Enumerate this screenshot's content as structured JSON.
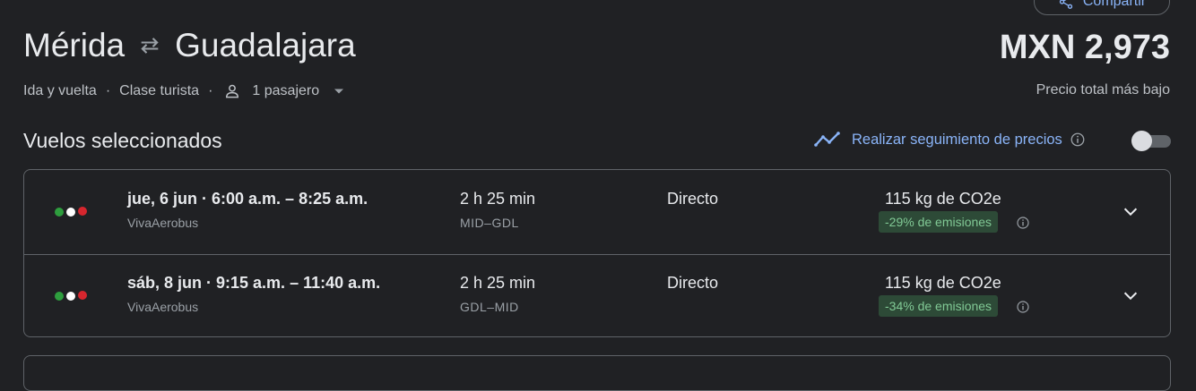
{
  "header": {
    "share_label": "Compartir",
    "origin": "Mérida",
    "destination": "Guadalajara",
    "trip_type": "Ida y vuelta",
    "cabin_class": "Clase turista",
    "passengers": "1 pasajero",
    "price": "MXN 2,973",
    "price_subtitle": "Precio total más bajo"
  },
  "section": {
    "title": "Vuelos seleccionados",
    "track_prices_label": "Realizar seguimiento de precios",
    "track_prices_enabled": false
  },
  "flights": [
    {
      "datetime": "jue, 6 jun  ·  6:00 a.m. – 8:25 a.m.",
      "airline": "VivaAerobus",
      "duration": "2 h 25 min",
      "route": "MID–GDL",
      "stops": "Directo",
      "emissions": "115 kg de CO2e",
      "emissions_badge": "-29% de emisiones"
    },
    {
      "datetime": "sáb, 8 jun  ·  9:15 a.m. – 11:40 a.m.",
      "airline": "VivaAerobus",
      "duration": "2 h 25 min",
      "route": "GDL–MID",
      "stops": "Directo",
      "emissions": "115 kg de CO2e",
      "emissions_badge": "-34% de emisiones"
    }
  ],
  "icons": {
    "share": "share-icon",
    "swap": "swap-arrows-icon",
    "person": "person-icon",
    "dropdown": "caret-down-icon",
    "trend": "trend-line-icon",
    "info": "info-icon",
    "expand": "chevron-down-icon"
  },
  "colors": {
    "background": "#202124",
    "accent": "#8ab4f8",
    "badge_bg": "#2d4a37",
    "badge_text": "#81c995",
    "logo_green": "#2e9e3e",
    "logo_white": "#ffffff",
    "logo_red": "#d6262e"
  }
}
